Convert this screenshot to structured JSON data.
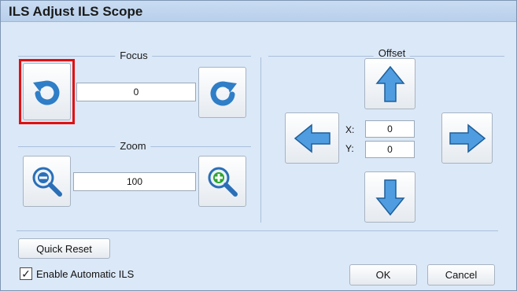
{
  "window": {
    "title": "ILS Adjust ILS Scope"
  },
  "focus": {
    "label": "Focus",
    "value": "0"
  },
  "zoom": {
    "label": "Zoom",
    "value": "100"
  },
  "offset": {
    "label": "Offset",
    "x_label": "X:",
    "y_label": "Y:",
    "x_value": "0",
    "y_value": "0"
  },
  "buttons": {
    "quick_reset": "Quick Reset",
    "ok": "OK",
    "cancel": "Cancel"
  },
  "checkbox": {
    "label": "Enable Automatic ILS",
    "checked": true
  },
  "colors": {
    "arrow_blue": "#3f8fd6",
    "highlight": "#e11010",
    "zoom_plus": "#2ea52e",
    "zoom_minus": "#2a6fb7"
  },
  "icons": [
    "rotate-ccw-icon",
    "rotate-cw-icon",
    "zoom-out-icon",
    "zoom-in-icon",
    "arrow-up-icon",
    "arrow-down-icon",
    "arrow-left-icon",
    "arrow-right-icon",
    "checkmark-icon"
  ]
}
